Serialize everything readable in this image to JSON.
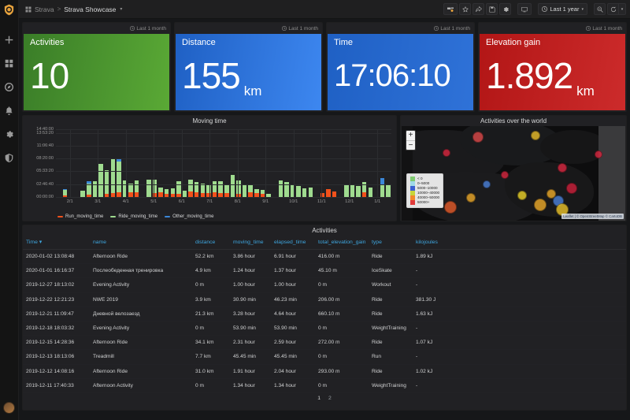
{
  "nav": {
    "brand_icon": "grafana-logo-icon",
    "items": [
      {
        "name": "create-icon",
        "label": "Create"
      },
      {
        "name": "dashboards-icon",
        "label": "Dashboards"
      },
      {
        "name": "explore-icon",
        "label": "Explore"
      },
      {
        "name": "alerting-icon",
        "label": "Alerting"
      },
      {
        "name": "configuration-icon",
        "label": "Configuration"
      },
      {
        "name": "server-admin-icon",
        "label": "Server Admin"
      }
    ],
    "avatar_label": "User profile"
  },
  "topnav": {
    "folder": "Strava",
    "separator": ">",
    "dashboard": "Strava Showcase",
    "caret": "▾",
    "actions": [
      {
        "name": "add-panel-button",
        "label": "Add panel"
      },
      {
        "name": "mark-favorite-button",
        "label": "Mark as favorite"
      },
      {
        "name": "share-dashboard-button",
        "label": "Share dashboard"
      },
      {
        "name": "save-dashboard-button",
        "label": "Save dashboard"
      },
      {
        "name": "dashboard-settings-button",
        "label": "Dashboard settings"
      },
      {
        "name": "cycle-view-mode-button",
        "label": "Cycle view mode"
      }
    ],
    "time_range": "Last 1 year",
    "zoom_out_label": "Zoom out time range",
    "refresh_label": "Refresh dashboard",
    "refresh_caret": "▾"
  },
  "stats": [
    {
      "title": "Activities",
      "value": "10",
      "unit": "",
      "time_info": "Last 1 month",
      "color": "#5aa935",
      "theme": "g-green"
    },
    {
      "title": "Distance",
      "value": "155",
      "unit": "km",
      "time_info": "Last 1 month",
      "color": "#3d87f0",
      "theme": "g-blue"
    },
    {
      "title": "Time",
      "value": "17:06:10",
      "unit": "",
      "time_info": "Last 1 month",
      "color": "#2f72d8",
      "theme": "g-blue2"
    },
    {
      "title": "Elevation gain",
      "value": "1.892",
      "unit": "km",
      "time_info": "Last 1 month",
      "color": "#cc2b2b",
      "theme": "g-red"
    }
  ],
  "graph": {
    "title": "Moving time"
  },
  "chart_data": {
    "type": "bar",
    "title": "Moving time",
    "xlabel": "",
    "ylabel": "",
    "stacked": true,
    "grid": true,
    "legend_position": "bottom-left",
    "ytick_labels": [
      "14:40:00",
      "13:53:20",
      "11:06:40",
      "08:20:00",
      "05:33:20",
      "02:46:40",
      "00:00:00"
    ],
    "ytick_values": [
      52800,
      50000,
      40000,
      30000,
      20000,
      10000,
      0
    ],
    "ylim": [
      0,
      52800
    ],
    "ytick_unit": "hh:mm:ss",
    "xtick_labels": [
      "2/1",
      "3/1",
      "4/1",
      "5/1",
      "6/1",
      "7/1",
      "8/1",
      "9/1",
      "10/1",
      "11/1",
      "12/1",
      "1/1"
    ],
    "series": [
      {
        "name": "Run_moving_time",
        "color": "#f2511b",
        "values": [
          0,
          1400,
          0,
          0,
          0,
          1600,
          0,
          0,
          2600,
          3000,
          3400,
          0,
          3800,
          3400,
          0,
          0,
          3000,
          3400,
          2600,
          2200,
          2400,
          0,
          4600,
          3600,
          2800,
          3200,
          3400,
          2800,
          3000,
          0,
          2600,
          0,
          3400,
          3200,
          2400,
          0,
          0,
          0,
          0,
          0,
          0,
          0,
          0,
          0,
          3200,
          6400,
          4600,
          0,
          0,
          0,
          0,
          3600,
          0,
          0,
          0,
          0
        ]
      },
      {
        "name": "Ride_moving_time",
        "color": "#9fdb8f",
        "values": [
          0,
          4200,
          0,
          0,
          4800,
          8800,
          12000,
          26000,
          18000,
          26600,
          24000,
          12800,
          6400,
          9200,
          0,
          13800,
          10400,
          4200,
          3400,
          4400,
          10000,
          5200,
          9200,
          8200,
          7800,
          6000,
          8600,
          9200,
          7000,
          17000,
          10200,
          9800,
          6000,
          3200,
          3200,
          2200,
          0,
          13000,
          11400,
          9200,
          8800,
          6800,
          7400,
          0,
          0,
          0,
          0,
          0,
          9600,
          9200,
          8400,
          8000,
          7600,
          0,
          9800,
          9000
        ]
      },
      {
        "name": "Other_moving_time",
        "color": "#3b87d8",
        "values": [
          0,
          800,
          0,
          0,
          0,
          1800,
          0,
          0,
          0,
          0,
          2600,
          0,
          0,
          0,
          0,
          0,
          0,
          0,
          0,
          0,
          0,
          0,
          0,
          0,
          0,
          0,
          0,
          0,
          0,
          0,
          0,
          0,
          0,
          0,
          0,
          0,
          0,
          0,
          0,
          0,
          0,
          0,
          0,
          0,
          0,
          0,
          0,
          0,
          0,
          0,
          0,
          0,
          0,
          0,
          5200,
          0
        ]
      }
    ]
  },
  "map": {
    "title": "Activities over the world",
    "zoom_in": "+",
    "zoom_out": "−",
    "attribution": "Leaflet | © OpenStreetMap © CartoDB",
    "legend": {
      "labels": [
        "< 0",
        "0–5000",
        "5000–10000",
        "10000–40000",
        "40000–50000",
        "50000+"
      ],
      "colors": [
        "#7ec96f",
        "#9fd9e8",
        "#3b5fd0",
        "#c7d53a",
        "#f2882b",
        "#e03b3b"
      ]
    },
    "markers": [
      {
        "x": 34,
        "y": 12,
        "r": 7,
        "color": "#d84848"
      },
      {
        "x": 60,
        "y": 10,
        "r": 6,
        "color": "#e8bc2a"
      },
      {
        "x": 72,
        "y": 44,
        "r": 6,
        "color": "#d6273f"
      },
      {
        "x": 46,
        "y": 52,
        "r": 5,
        "color": "#d6273f"
      },
      {
        "x": 38,
        "y": 62,
        "r": 5,
        "color": "#4a7fd6"
      },
      {
        "x": 31,
        "y": 76,
        "r": 6,
        "color": "#e8a72a"
      },
      {
        "x": 54,
        "y": 73,
        "r": 6,
        "color": "#e8d02a"
      },
      {
        "x": 76,
        "y": 66,
        "r": 7,
        "color": "#c9203a"
      },
      {
        "x": 67,
        "y": 72,
        "r": 6,
        "color": "#e8a72a"
      },
      {
        "x": 70,
        "y": 79,
        "r": 7,
        "color": "#4a7fd6"
      },
      {
        "x": 62,
        "y": 83,
        "r": 8,
        "color": "#e8a72a"
      },
      {
        "x": 72,
        "y": 88,
        "r": 8,
        "color": "#e8c02a"
      },
      {
        "x": 22,
        "y": 86,
        "r": 8,
        "color": "#e05a2a"
      },
      {
        "x": 88,
        "y": 30,
        "r": 5,
        "color": "#d6273f"
      },
      {
        "x": 20,
        "y": 28,
        "r": 5,
        "color": "#d6273f"
      }
    ]
  },
  "table": {
    "title": "Activities",
    "columns": [
      {
        "key": "time",
        "label": "Time",
        "sort": "▾"
      },
      {
        "key": "name",
        "label": "name"
      },
      {
        "key": "distance",
        "label": "distance"
      },
      {
        "key": "moving_time",
        "label": "moving_time"
      },
      {
        "key": "elapsed_time",
        "label": "elapsed_time"
      },
      {
        "key": "total_elevation_gain",
        "label": "total_elevation_gain"
      },
      {
        "key": "type",
        "label": "type"
      },
      {
        "key": "kilojoules",
        "label": "kilojoules"
      }
    ],
    "rows": [
      [
        "2020-01-02 13:08:48",
        "Afternoon Ride",
        "52.2 km",
        "3.86 hour",
        "6.91 hour",
        "416.00 m",
        "Ride",
        "1.89 kJ"
      ],
      [
        "2020-01-01 16:16:37",
        "Послеобеденная тренировка",
        "4.9 km",
        "1.24 hour",
        "1.37 hour",
        "45.10 m",
        "IceSkate",
        "-"
      ],
      [
        "2019-12-27 18:13:02",
        "Evening Activity",
        "0 m",
        "1.00 hour",
        "1.00 hour",
        "0 m",
        "Workout",
        "-"
      ],
      [
        "2019-12-22 12:21:23",
        "NWE 2019",
        "3.9 km",
        "30.90 min",
        "46.23 min",
        "206.00 m",
        "Ride",
        "381.30 J"
      ],
      [
        "2019-12-21 11:09:47",
        "Дневной велозаезд",
        "21.3 km",
        "3.28 hour",
        "4.64 hour",
        "660.10 m",
        "Ride",
        "1.63 kJ"
      ],
      [
        "2019-12-18 18:03:32",
        "Evening Activity",
        "0 m",
        "53.90 min",
        "53.90 min",
        "0 m",
        "WeightTraining",
        "-"
      ],
      [
        "2019-12-15 14:28:36",
        "Afternoon Ride",
        "34.1 km",
        "2.31 hour",
        "2.59 hour",
        "272.00 m",
        "Ride",
        "1.07 kJ"
      ],
      [
        "2019-12-13 18:13:06",
        "Treadmill",
        "7.7 km",
        "45.45 min",
        "45.45 min",
        "0 m",
        "Run",
        "-"
      ],
      [
        "2019-12-12 14:08:16",
        "Afternoon Ride",
        "31.0 km",
        "1.91 hour",
        "2.04 hour",
        "293.00 m",
        "Ride",
        "1.02 kJ"
      ],
      [
        "2019-12-11 17:40:33",
        "Afternoon Activity",
        "0 m",
        "1.34 hour",
        "1.34 hour",
        "0 m",
        "WeightTraining",
        "-"
      ]
    ],
    "pagination": [
      "1",
      "2"
    ],
    "active_page": "1"
  }
}
